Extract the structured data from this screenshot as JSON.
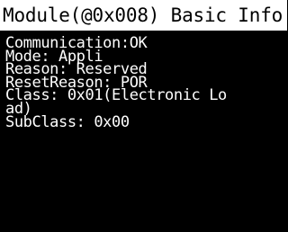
{
  "title": "Module(@0x008) Basic Info",
  "lines": [
    "Communication:OK",
    "Mode: Appli",
    "Reason: Reserved",
    "ResetReason: POR",
    "Class: 0x01(Electronic Lo",
    "ad)",
    "SubClass: 0x00"
  ],
  "colors": {
    "background": "#000000",
    "title_bar": "#ffffff",
    "title_text": "#000000",
    "text": "#ffffff"
  }
}
